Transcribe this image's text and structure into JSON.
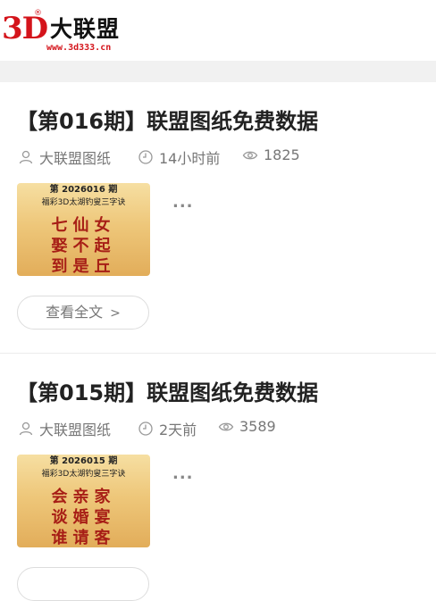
{
  "logo": {
    "mark": "3D",
    "reg": "®",
    "name": "大联盟",
    "url": "www.3d333.cn"
  },
  "articles": [
    {
      "title": "【第016期】联盟图纸免费数据",
      "author": "大联盟图纸",
      "time": "14小时前",
      "views": "1825",
      "thumb_issue": "第 2026016 期",
      "thumb_sub": "福彩3D太湖钓叟三字诀",
      "poem": [
        "七仙女",
        "娶不起",
        "到是丘"
      ],
      "excerpt": "...",
      "read_more": "查看全文"
    },
    {
      "title": "【第015期】联盟图纸免费数据",
      "author": "大联盟图纸",
      "time": "2天前",
      "views": "3589",
      "thumb_issue": "第 2026015 期",
      "thumb_sub": "福彩3D太湖钓叟三字诀",
      "poem": [
        "会亲家",
        "谈婚宴",
        "谁请客"
      ],
      "excerpt": "...",
      "read_more": ""
    }
  ],
  "colors": {
    "brand_red": "#d4141b",
    "divider": "#f1f1f1",
    "poem_red": "#a71e16"
  },
  "icons": {
    "author": "user-icon",
    "time": "clock-icon",
    "views": "eye-icon",
    "more": "chevron-right-icon"
  }
}
